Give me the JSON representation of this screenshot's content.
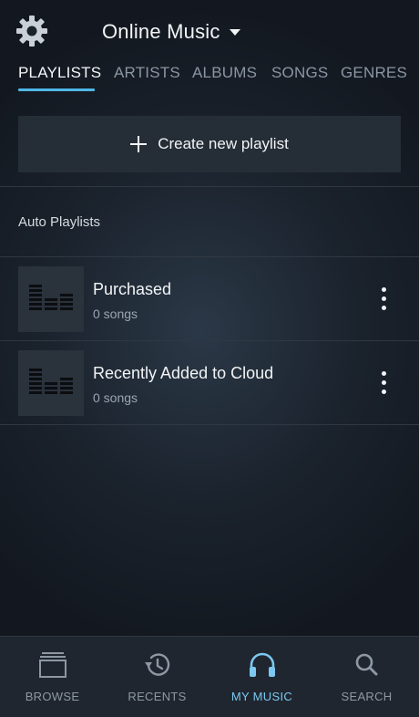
{
  "header": {
    "settings_icon": "gear-icon",
    "source_label": "Online Music",
    "source_dropdown_icon": "caret-down-icon"
  },
  "tabs": [
    {
      "label": "PLAYLISTS",
      "active": true
    },
    {
      "label": "ARTISTS",
      "active": false
    },
    {
      "label": "ALBUMS",
      "active": false
    },
    {
      "label": "SONGS",
      "active": false
    },
    {
      "label": "GENRES",
      "active": false
    }
  ],
  "create_playlist": {
    "icon": "plus-icon",
    "label": "Create new playlist"
  },
  "auto_playlists": {
    "title": "Auto Playlists",
    "items": [
      {
        "title": "Purchased",
        "subtitle": "0 songs",
        "icon": "equalizer-icon"
      },
      {
        "title": "Recently Added to Cloud",
        "subtitle": "0 songs",
        "icon": "equalizer-icon"
      }
    ]
  },
  "bottom_nav": [
    {
      "label": "BROWSE",
      "icon": "browse-icon",
      "active": false
    },
    {
      "label": "RECENTS",
      "icon": "history-icon",
      "active": false
    },
    {
      "label": "MY MUSIC",
      "icon": "headphones-icon",
      "active": true
    },
    {
      "label": "SEARCH",
      "icon": "search-icon",
      "active": false
    }
  ],
  "colors": {
    "accent": "#4fb7e6",
    "active_nav": "#7cc8f0",
    "background": "#1a222c",
    "card": "#252d37"
  }
}
